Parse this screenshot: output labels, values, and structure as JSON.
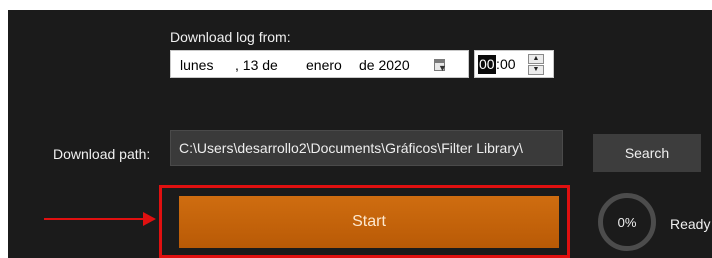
{
  "download_log": {
    "label": "Download log from:",
    "date": {
      "weekday": "lunes",
      "day": ", 13 de",
      "month": "enero",
      "year": "de 2020",
      "calendar_icon": "calendar-dropdown-icon"
    },
    "time": {
      "hours": "00",
      "separator": ":",
      "minutes": "00",
      "spin_up_icon": "spin-up-icon",
      "spin_down_icon": "spin-down-icon"
    }
  },
  "download_path": {
    "label": "Download path:",
    "value": "C:\\Users\\desarrollo2\\Documents\\Gráficos\\Filter Library\\"
  },
  "search_button": {
    "label": "Search"
  },
  "start_button": {
    "label": "Start"
  },
  "progress": {
    "value": 0,
    "text": "0%"
  },
  "status": {
    "text": "Ready"
  },
  "annotations": {
    "highlight_color": "#e01010",
    "arrow_icon": "red-arrow-right-icon"
  },
  "colors": {
    "background": "#1b1b1b",
    "accent": "#c4650b",
    "button": "#3d3d3d"
  }
}
